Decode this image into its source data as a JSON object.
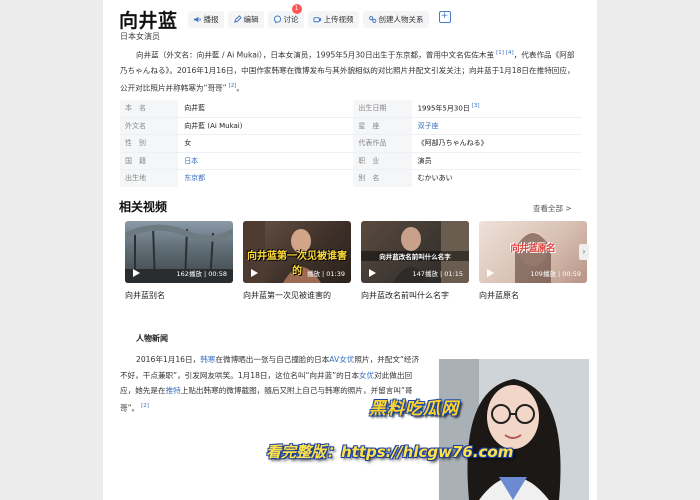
{
  "header": {
    "title": "向井蓝",
    "actions": [
      {
        "label": "播报"
      },
      {
        "label": "编辑"
      },
      {
        "label": "讨论",
        "badge": "1"
      },
      {
        "label": "上传视频"
      },
      {
        "label": "创建人物关系"
      }
    ],
    "plus": "+"
  },
  "subtitle": "日本女演员",
  "summary": {
    "text1": "向井蓝（外文名：向井藍 / Ai Mukai），日本女演员，1995年5月30日出生于东京都，曾用中文名佐佐木茧",
    "sup1": "[1]",
    "sup2": "[4]",
    "text2": "，代表作品《阿部乃ちゃんねる》。2016年1月16日，中国作家韩寒在微博发布与其外貌相似的对比照片并配文引发关注；向井蓝于1月18日在推特回应，公开对比照片并称韩寒为“哥哥”",
    "sup3": "[2]",
    "text3": "。"
  },
  "info": {
    "rows": [
      {
        "k1": "本名",
        "v1": "向井藍",
        "k2": "出生日期",
        "v2": "1995年5月30日",
        "sup2": "[3]"
      },
      {
        "k1": "外文名",
        "v1": "向井藍 (Ai Mukai)",
        "k2": "星座",
        "v2": "双子座"
      },
      {
        "k1": "性别",
        "v1": "女",
        "k2": "代表作品",
        "v2": "《阿部乃ちゃんねる》"
      },
      {
        "k1": "国籍",
        "v1": "日本",
        "k2": "职业",
        "v2": "演员"
      },
      {
        "k1": "出生地",
        "v1": "东京都",
        "k2": "别名",
        "v2": "むかいあい"
      }
    ]
  },
  "videos_section": {
    "title": "相关视频",
    "more": "查看全部 >",
    "items": [
      {
        "stat": "162播放 | 00:58",
        "caption": "",
        "label": "向井蓝别名"
      },
      {
        "stat": "播放 | 01:39",
        "caption": "向井蓝第一次见被谁害的",
        "label": "向井蓝第一次见被谁害的"
      },
      {
        "stat": "147播放 | 01:15",
        "caption": "向井蓝改名前叫什么名字",
        "label": "向井蓝改名前叫什么名字"
      },
      {
        "stat": "109播放 | 00:59",
        "caption": "向井蓝原名",
        "label": "向井蓝原名"
      }
    ]
  },
  "news": {
    "title": "人物新闻",
    "t1": "2016年1月16日，",
    "l1": "韩寒",
    "t2": "在微博晒出一张与自己撞脸的日本",
    "l2": "AV女优",
    "t3": "照片，并配文“经济不好，干点兼职”，引发网友哄笑。1月18日，这位名叫“向井蓝”的日本",
    "l3": "女优",
    "t4": "对此做出回应，她先是在",
    "l4": "推特",
    "t5": "上贴出韩寒的微博截图，随后又附上自己与韩寒的照片，并留言叫“哥哥”。",
    "sup": "[2]"
  },
  "watermark": {
    "line1": "黑料吃瓜网",
    "line2": "看完整版：https://hlcgw76.com"
  },
  "colors": {
    "link": "#3a6fbf",
    "badge": "#ff5555",
    "watermark": "#ffd12a"
  }
}
